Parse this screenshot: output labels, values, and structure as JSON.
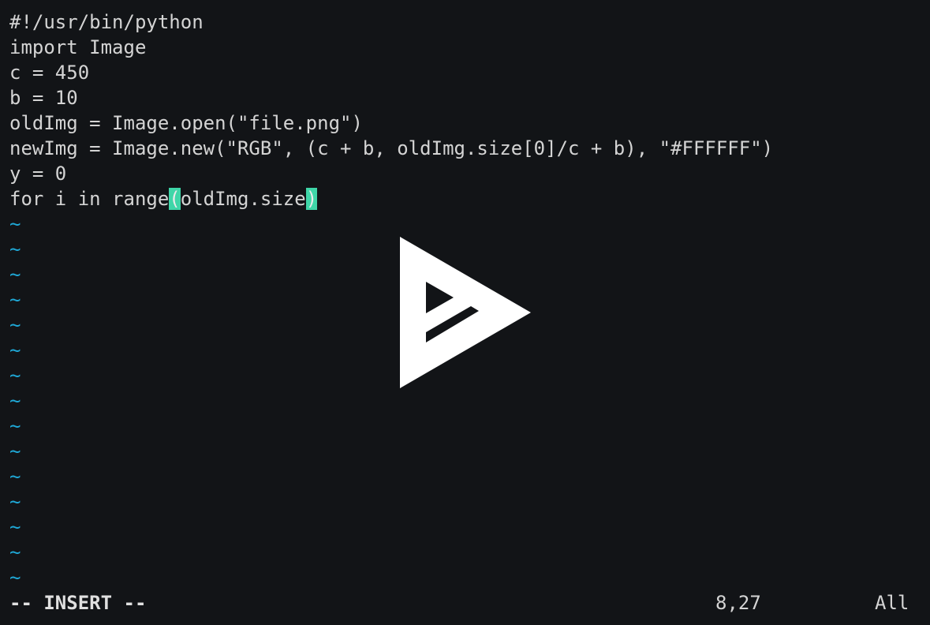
{
  "editor": {
    "lines": [
      "#!/usr/bin/python",
      "import Image",
      "c = 450",
      "b = 10",
      "oldImg = Image.open(\"file.png\")",
      "newImg = Image.new(\"RGB\", (c + b, oldImg.size[0]/c + b), \"#FFFFFF\")",
      "y = 0"
    ],
    "current_line": {
      "before": "for i in range",
      "match_open": "(",
      "middle": "oldImg.size",
      "match_close": ")"
    },
    "empty_marker": "~",
    "empty_line_count": 15
  },
  "status": {
    "mode": "-- INSERT --",
    "position": "8,27",
    "scroll": "All"
  },
  "overlay": {
    "icon": "asciinema-play-icon"
  },
  "colors": {
    "background": "#121417",
    "text": "#d4d4d4",
    "tilde": "#1fa8d6",
    "match_highlight": "#3fd6a8"
  }
}
